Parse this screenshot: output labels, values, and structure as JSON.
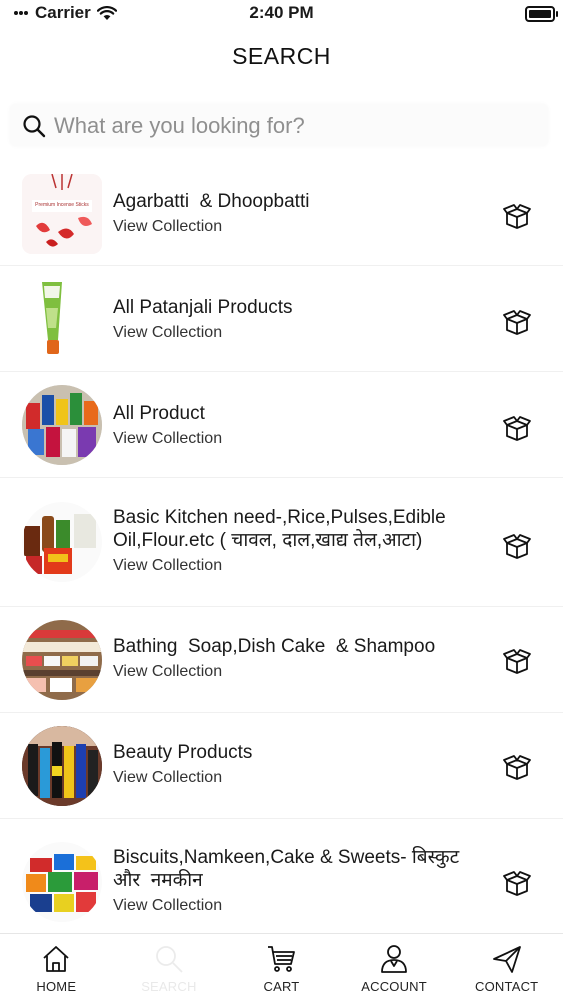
{
  "status_bar": {
    "carrier": "Carrier",
    "time": "2:40 PM"
  },
  "header": {
    "title": "SEARCH"
  },
  "search": {
    "placeholder": "What are you looking for?",
    "value": ""
  },
  "collections": [
    {
      "title": "Agarbatti  & Dhoopbatti",
      "subtitle": "View Collection",
      "thumb_label": "Premium Incense Sticks"
    },
    {
      "title": "All Patanjali Products",
      "subtitle": "View Collection"
    },
    {
      "title": "All Product",
      "subtitle": "View Collection"
    },
    {
      "title": "Basic Kitchen need-,Rice,Pulses,Edible Oil,Flour.etc ( चावल, दाल,खाद्य तेल,आटा)",
      "subtitle": "View Collection"
    },
    {
      "title": "Bathing  Soap,Dish Cake  & Shampoo",
      "subtitle": "View Collection"
    },
    {
      "title": "Beauty Products",
      "subtitle": "View Collection"
    },
    {
      "title": "Biscuits,Namkeen,Cake & Sweets- बिस्कुट और  नमकीन",
      "subtitle": "View Collection"
    }
  ],
  "tabbar": {
    "home": "HOME",
    "search": "SEARCH",
    "cart": "CART",
    "account": "ACCOUNT",
    "contact": "CONTACT"
  },
  "colors": {
    "text": "#1a1a1a",
    "placeholder": "#8f8f8f",
    "active_tab_faded": "#e9e9e9"
  }
}
